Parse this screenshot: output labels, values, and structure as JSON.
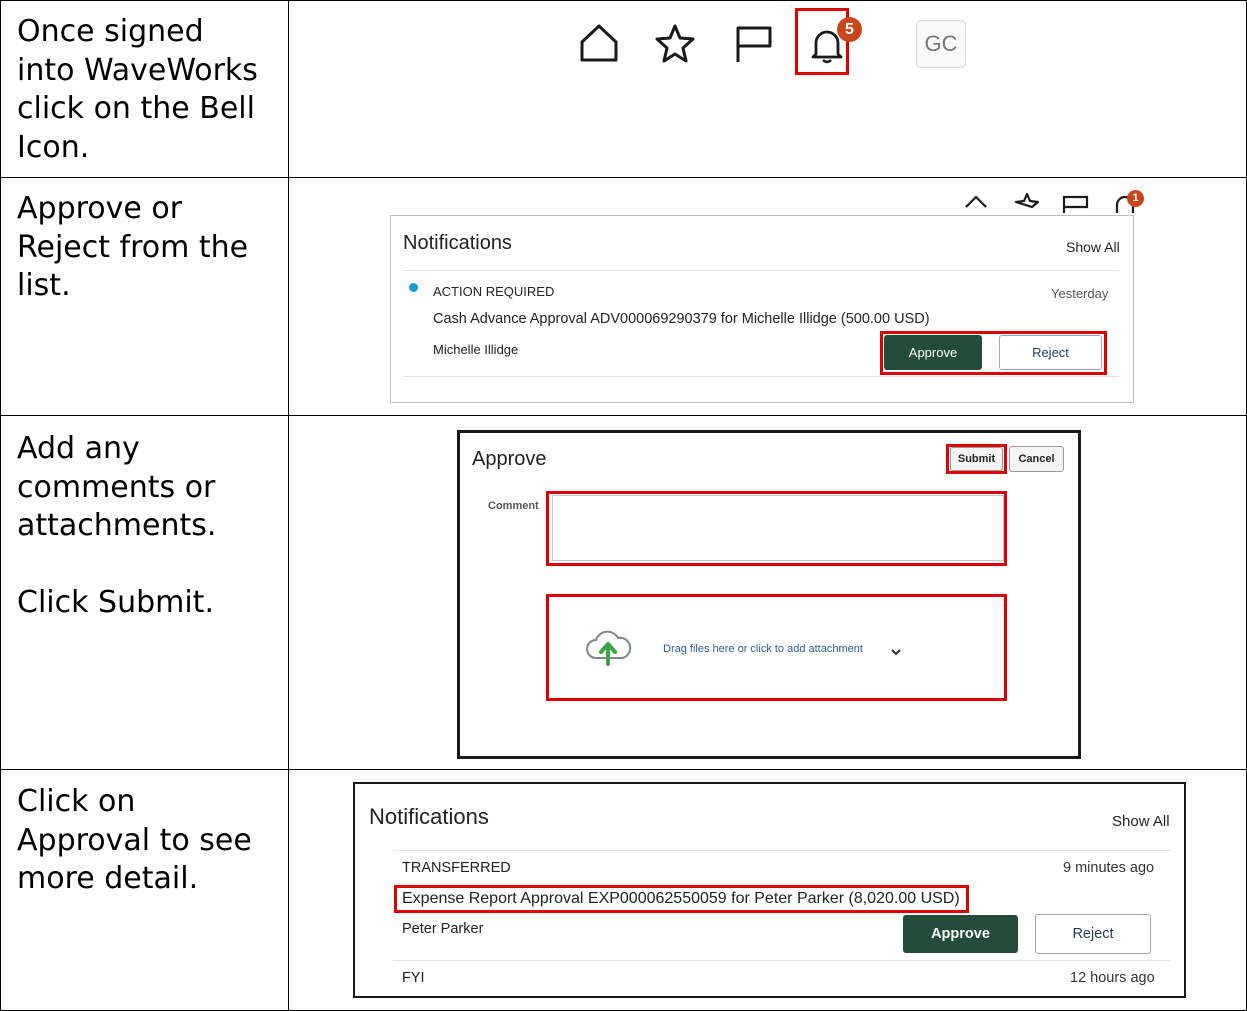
{
  "steps": [
    {
      "instruction": "Once signed\ninto WaveWorks\nclick on the Bell\nIcon."
    },
    {
      "instruction": "Approve or\nReject from the\nlist."
    },
    {
      "instruction": "Add any\ncomments or\nattachments.\n\nClick Submit."
    },
    {
      "instruction": "Click on\nApproval to see\nmore detail."
    }
  ],
  "toolbar": {
    "bell_badge_count": "5",
    "avatar_initials": "GC",
    "icons": [
      "home-icon",
      "star-icon",
      "flag-icon",
      "bell-icon"
    ]
  },
  "notifications_1": {
    "title": "Notifications",
    "show_all": "Show All",
    "bell_badge_count": "1",
    "item": {
      "status": "ACTION REQUIRED",
      "time": "Yesterday",
      "link": "Cash Advance Approval ADV000069290379 for Michelle Illidge (500.00 USD)",
      "person": "Michelle Illidge",
      "approve_label": "Approve",
      "reject_label": "Reject"
    }
  },
  "approve_dialog": {
    "title": "Approve",
    "submit_label": "Submit",
    "cancel_label": "Cancel",
    "comment_label": "Comment",
    "comment_value": "",
    "attachment_text": "Drag files here or click to add attachment"
  },
  "notifications_2": {
    "title": "Notifications",
    "show_all": "Show All",
    "item": {
      "status": "TRANSFERRED",
      "time": "9 minutes ago",
      "link": "Expense Report Approval EXP000062550059 for Peter Parker (8,020.00 USD)",
      "person": "Peter Parker",
      "approve_label": "Approve",
      "reject_label": "Reject"
    },
    "next_item": {
      "status": "FYI",
      "time": "12 hours ago"
    }
  },
  "colors": {
    "highlight_red": "#e00000",
    "brand_green": "#234d3a",
    "link_blue": "#2b6ba6",
    "badge_orange": "#c9451c",
    "unread_dot": "#1a9bd7"
  }
}
